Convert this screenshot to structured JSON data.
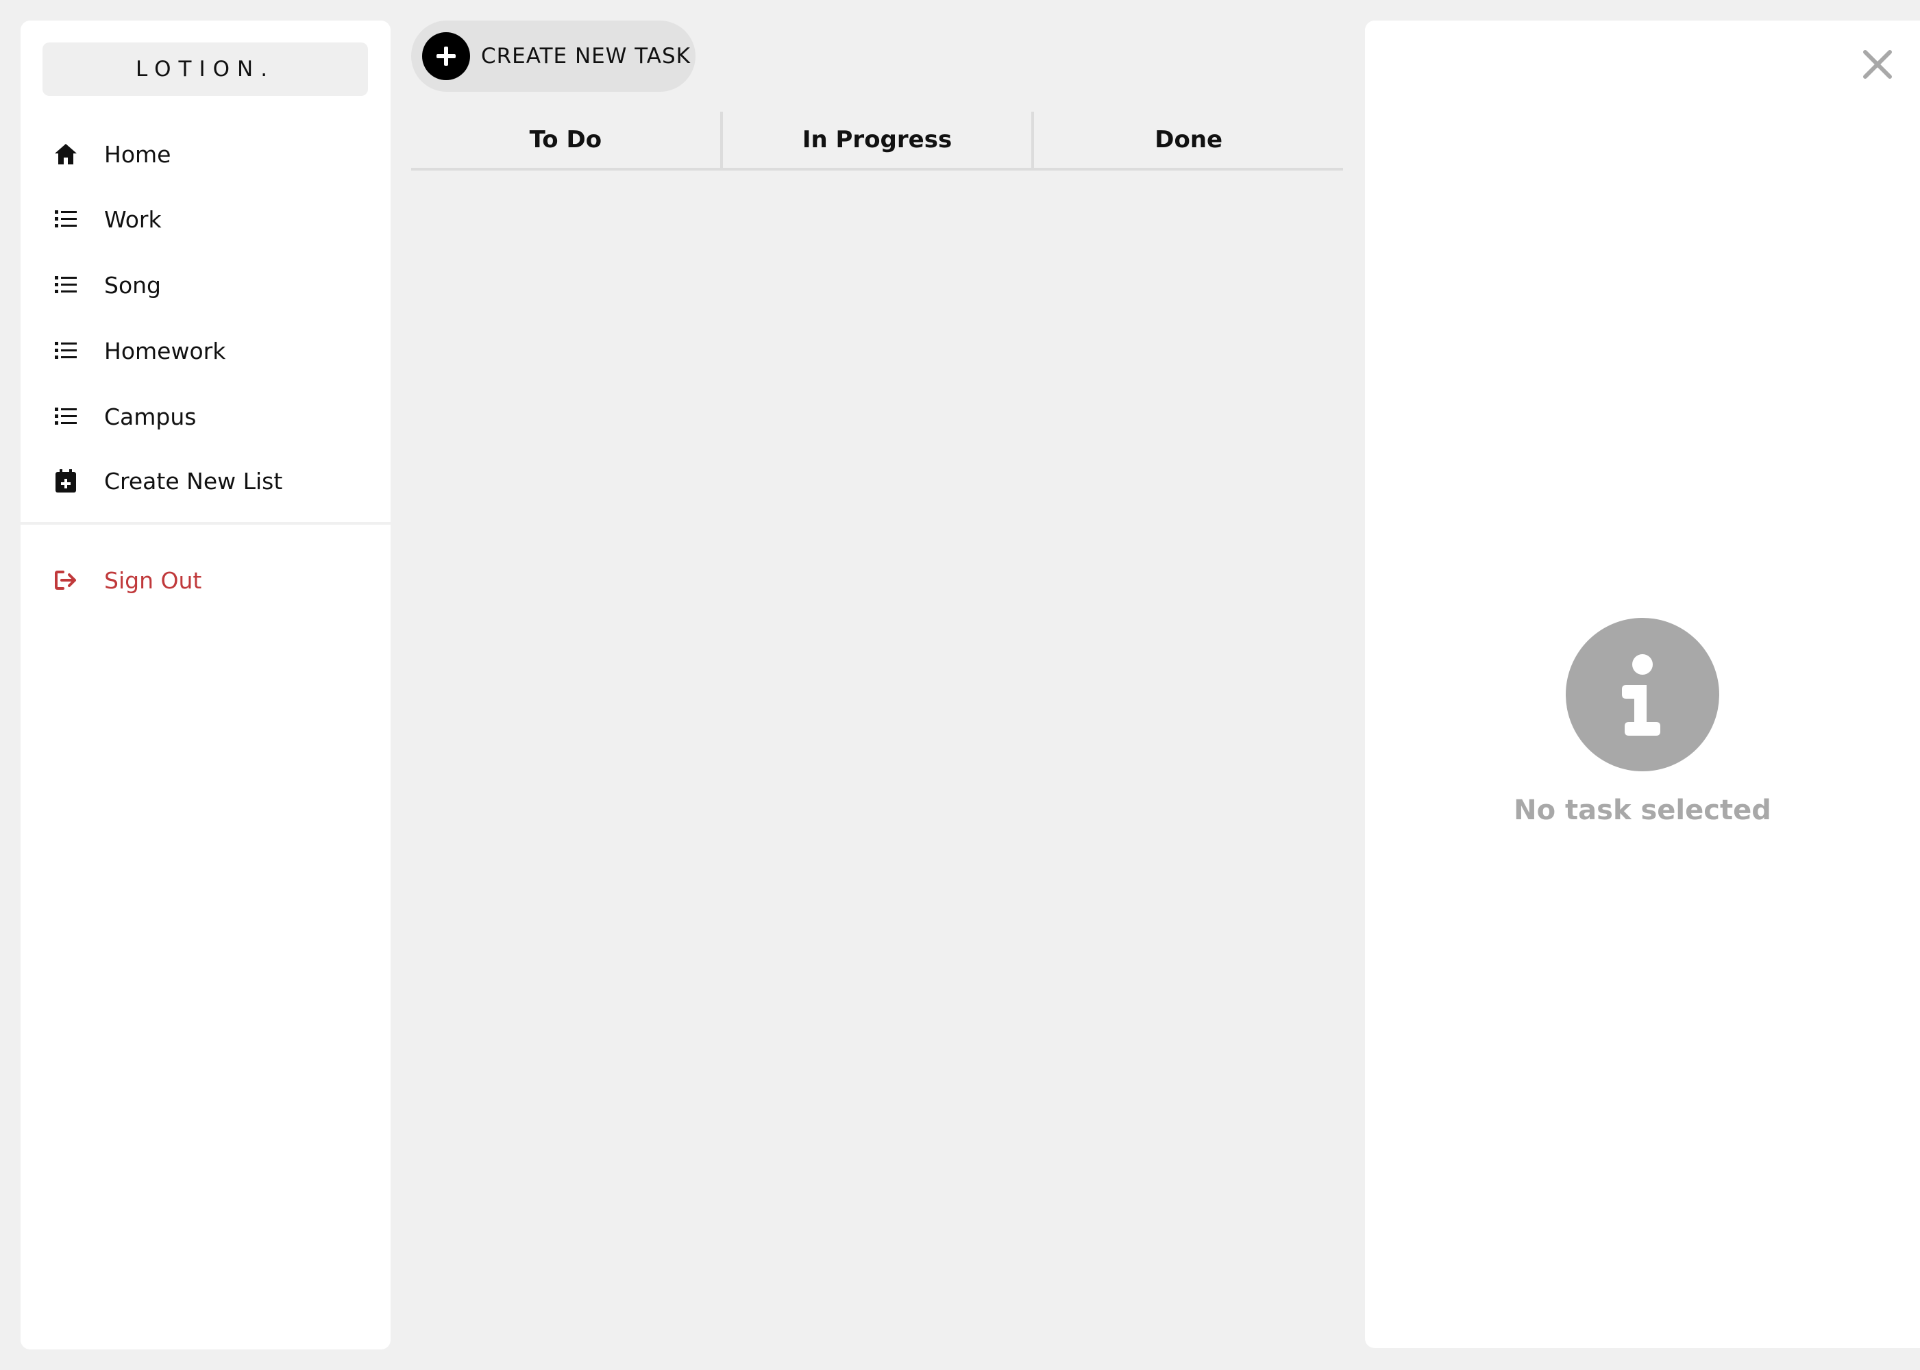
{
  "sidebar": {
    "brand": "LOTION.",
    "items": [
      {
        "label": "Home",
        "icon": "home-icon"
      },
      {
        "label": "Work",
        "icon": "list-icon"
      },
      {
        "label": "Song",
        "icon": "list-icon"
      },
      {
        "label": "Homework",
        "icon": "list-icon"
      },
      {
        "label": "Campus",
        "icon": "list-icon"
      },
      {
        "label": "Create New List",
        "icon": "calendar-plus-icon"
      }
    ],
    "signout": {
      "label": "Sign Out",
      "icon": "sign-out-icon",
      "color": "#c0393b"
    }
  },
  "toolbar": {
    "create_task_label": "CREATE NEW TASK"
  },
  "board": {
    "columns": [
      "To Do",
      "In Progress",
      "Done"
    ]
  },
  "detail": {
    "empty_message": "No task selected",
    "close_icon": "close-icon",
    "info_icon": "info-icon"
  },
  "colors": {
    "background": "#f0f0f0",
    "panel": "#ffffff",
    "muted": "#a8a8a8",
    "danger": "#c0393b"
  }
}
